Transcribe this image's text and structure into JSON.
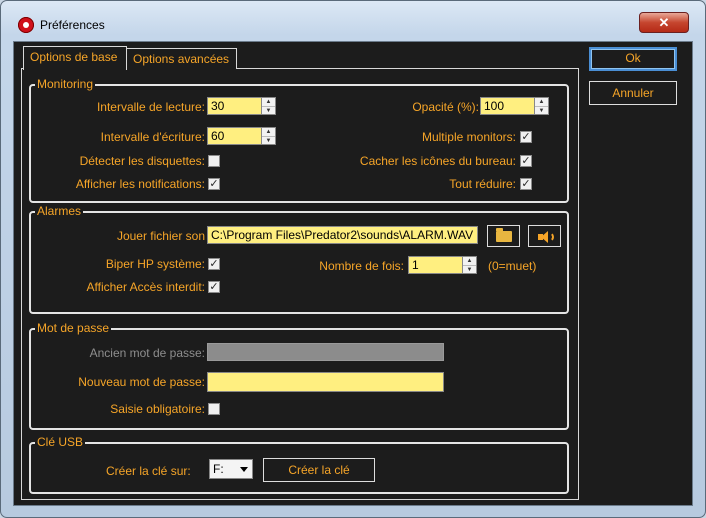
{
  "window": {
    "title": "Préférences",
    "close_glyph": "✕"
  },
  "tabs": [
    {
      "label": "Options de base"
    },
    {
      "label": "Options avancées"
    }
  ],
  "monitoring": {
    "legend": "Monitoring",
    "read_interval": {
      "label": "Intervalle de lecture:",
      "value": "30"
    },
    "write_interval": {
      "label": "Intervalle d'écriture:",
      "value": "60"
    },
    "detect_floppies": {
      "label": "Détecter les disquettes:",
      "checked": false
    },
    "show_notifications": {
      "label": "Afficher les notifications:",
      "checked": true
    },
    "opacity": {
      "label": "Opacité (%):",
      "value": "100"
    },
    "multiple_monitors": {
      "label": "Multiple monitors:",
      "checked": true
    },
    "hide_desktop_icons": {
      "label": "Cacher les icônes du bureau:",
      "checked": true
    },
    "minimize_all": {
      "label": "Tout réduire:",
      "checked": true
    }
  },
  "alarms": {
    "legend": "Alarmes",
    "sound_file": {
      "label": "Jouer fichier son",
      "value": "C:\\Program Files\\Predator2\\sounds\\ALARM.WAV"
    },
    "system_beep": {
      "label": "Biper HP système:",
      "checked": true
    },
    "repeat_count": {
      "label": "Nombre de fois:",
      "value": "1",
      "hint": "(0=muet)"
    },
    "show_access_denied": {
      "label": "Afficher Accès interdit:",
      "checked": true
    }
  },
  "password": {
    "legend": "Mot de passe",
    "old": {
      "label": "Ancien mot de passe:",
      "value": ""
    },
    "new": {
      "label": "Nouveau mot de passe:",
      "value": ""
    },
    "required": {
      "label": "Saisie obligatoire:",
      "checked": false
    }
  },
  "usb": {
    "legend": "Clé USB",
    "create_on_label": "Créer la clé sur:",
    "drive": "F:",
    "create_button": "Créer la clé"
  },
  "buttons": {
    "ok": "Ok",
    "cancel": "Annuler"
  },
  "icons": {
    "app": "predator-icon",
    "browse": "folder-open-icon",
    "play": "speaker-icon",
    "check": "✓"
  },
  "colors": {
    "accent": "#f6a528",
    "panel": "#1c1c1c",
    "input": "#ffef80"
  }
}
